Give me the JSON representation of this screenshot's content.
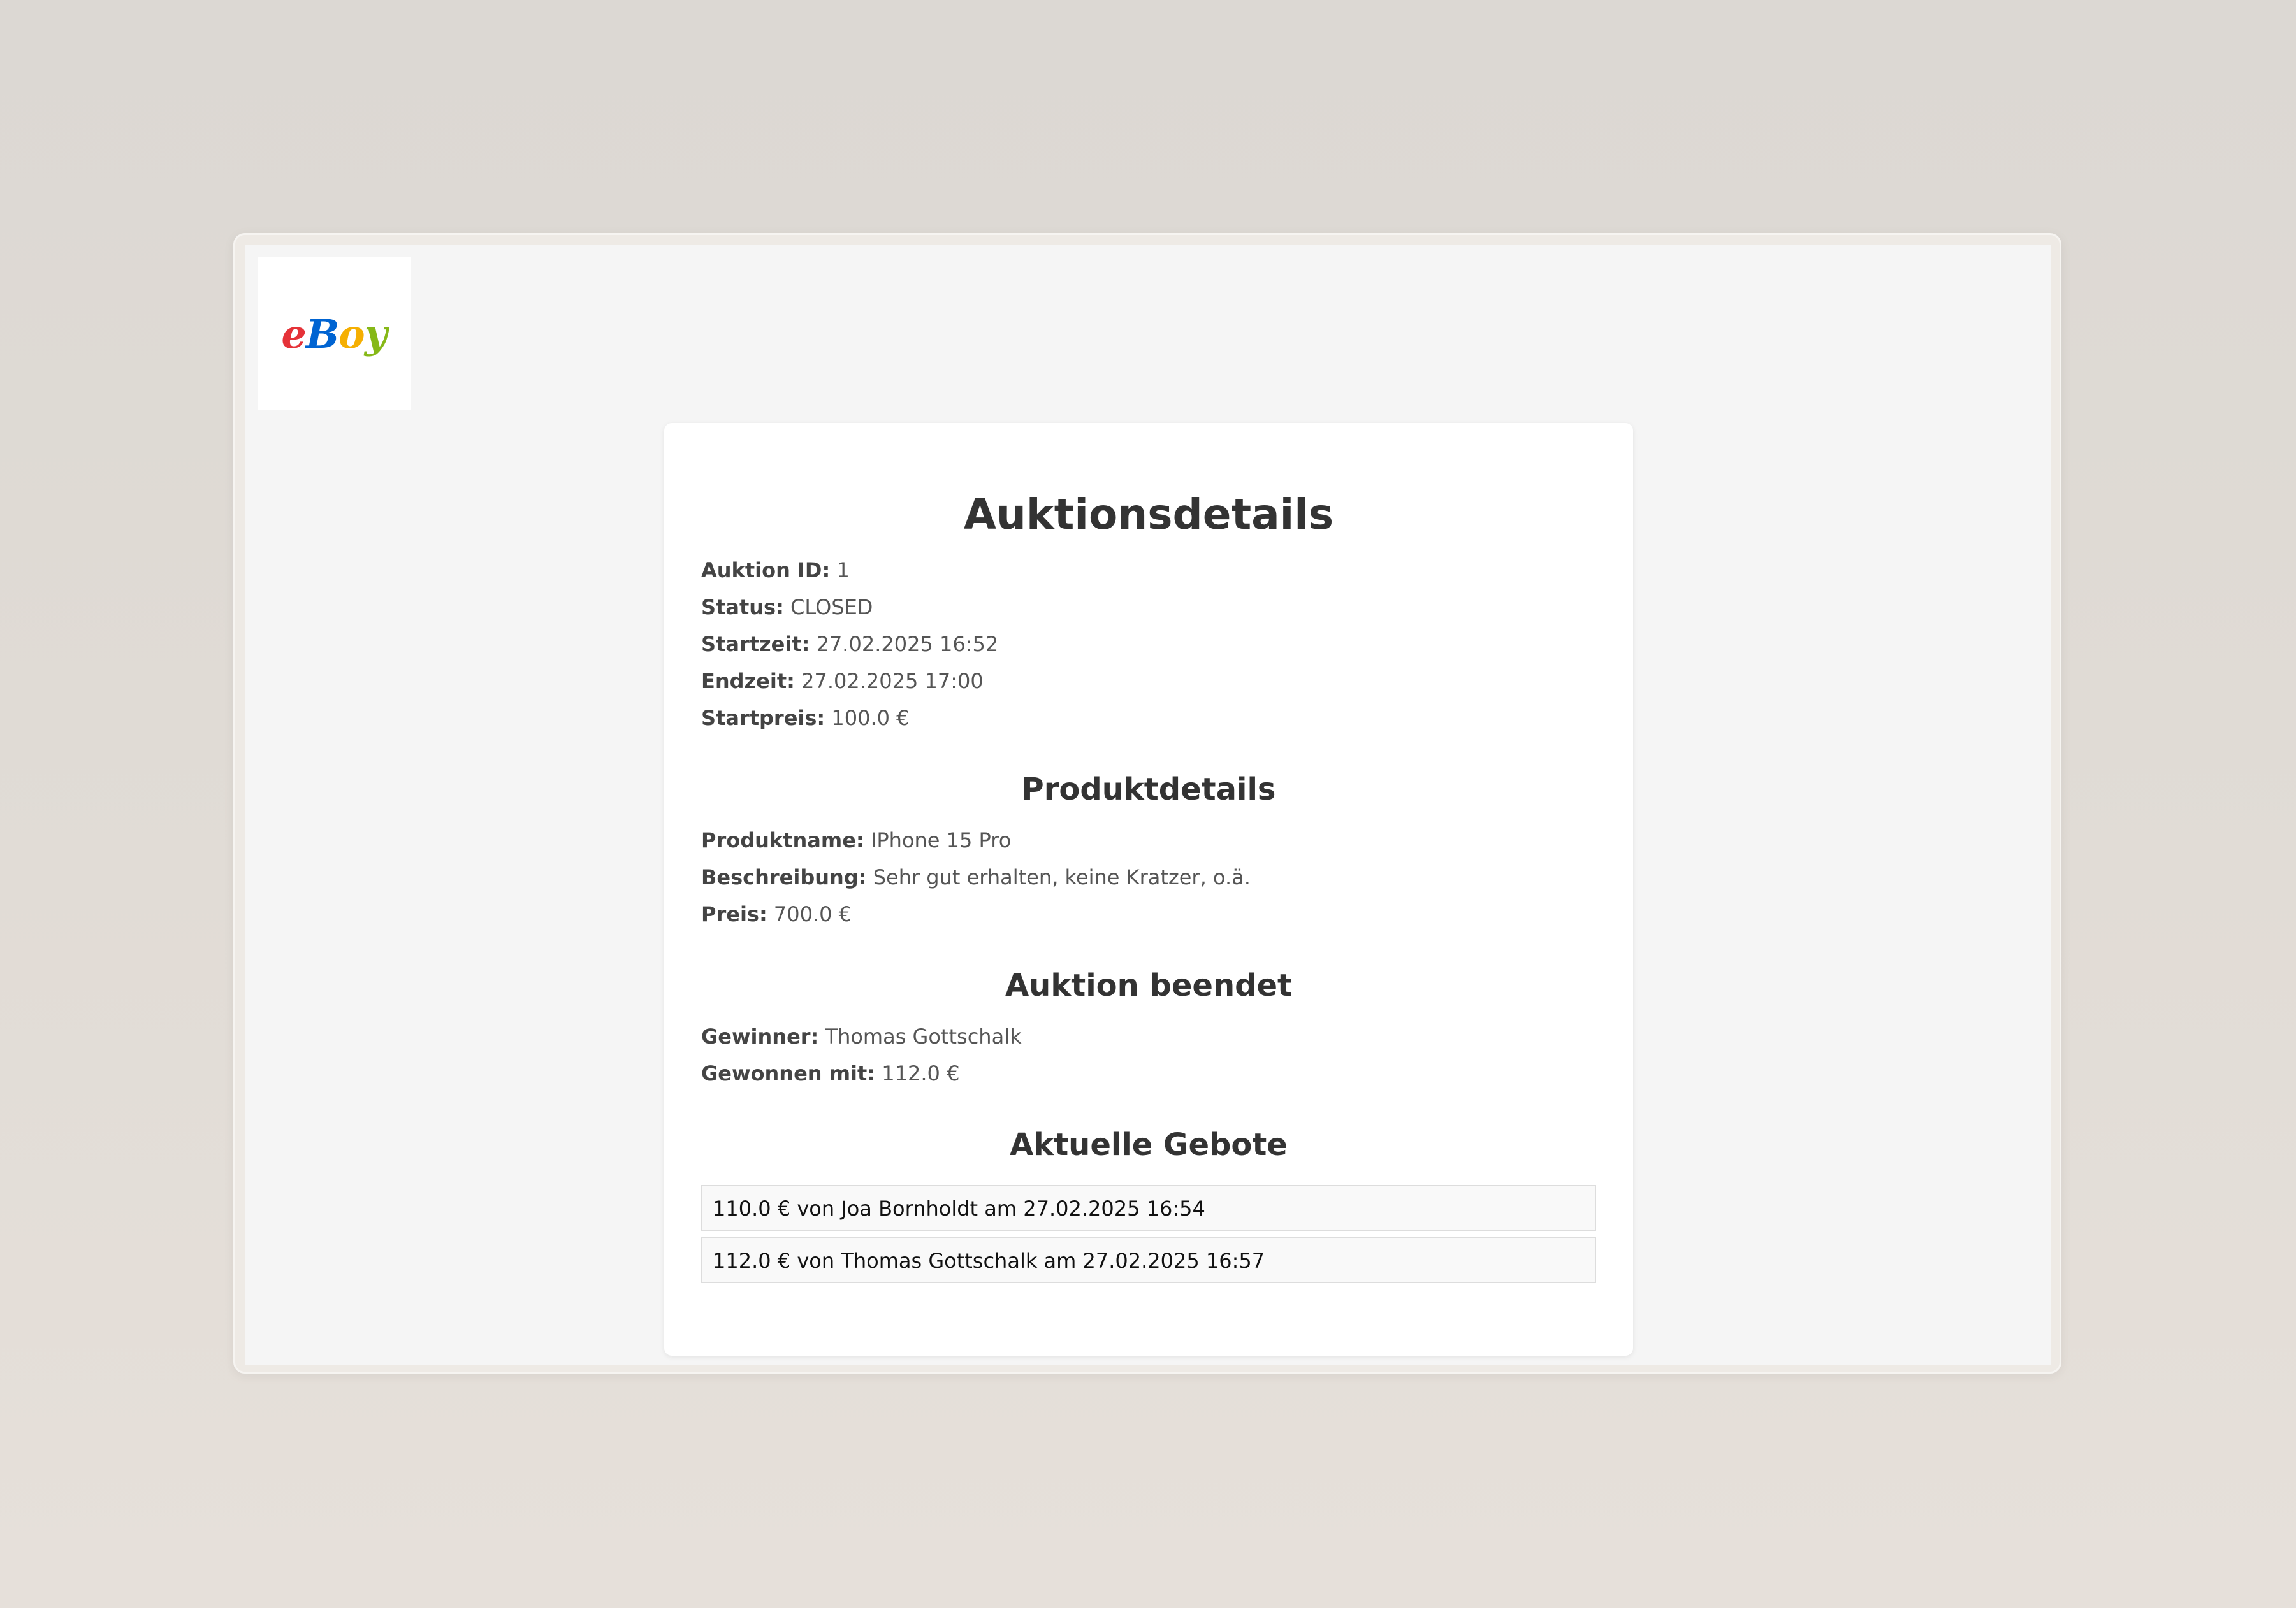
{
  "logo": {
    "letters": [
      {
        "char": "e",
        "color": "#e53238"
      },
      {
        "char": "B",
        "color": "#0064d2"
      },
      {
        "char": "o",
        "color": "#f5af02"
      },
      {
        "char": "y",
        "color": "#86b817"
      }
    ]
  },
  "auction": {
    "title": "Auktionsdetails",
    "fields": [
      {
        "label": "Auktion ID:",
        "value": "1"
      },
      {
        "label": "Status:",
        "value": "CLOSED"
      },
      {
        "label": "Startzeit:",
        "value": "27.02.2025 16:52"
      },
      {
        "label": "Endzeit:",
        "value": "27.02.2025 17:00"
      },
      {
        "label": "Startpreis:",
        "value": "100.0 €"
      }
    ]
  },
  "product": {
    "title": "Produktdetails",
    "fields": [
      {
        "label": "Produktname:",
        "value": "IPhone 15 Pro"
      },
      {
        "label": "Beschreibung:",
        "value": "Sehr gut erhalten, keine Kratzer, o.ä."
      },
      {
        "label": "Preis:",
        "value": "700.0 €"
      }
    ]
  },
  "result": {
    "title": "Auktion beendet",
    "fields": [
      {
        "label": "Gewinner:",
        "value": "Thomas Gottschalk"
      },
      {
        "label": "Gewonnen mit:",
        "value": "112.0 €"
      }
    ]
  },
  "bids": {
    "title": "Aktuelle Gebote",
    "items": [
      "110.0 € von Joa Bornholdt am 27.02.2025 16:54",
      "112.0 € von Thomas Gottschalk am 27.02.2025 16:57"
    ]
  }
}
